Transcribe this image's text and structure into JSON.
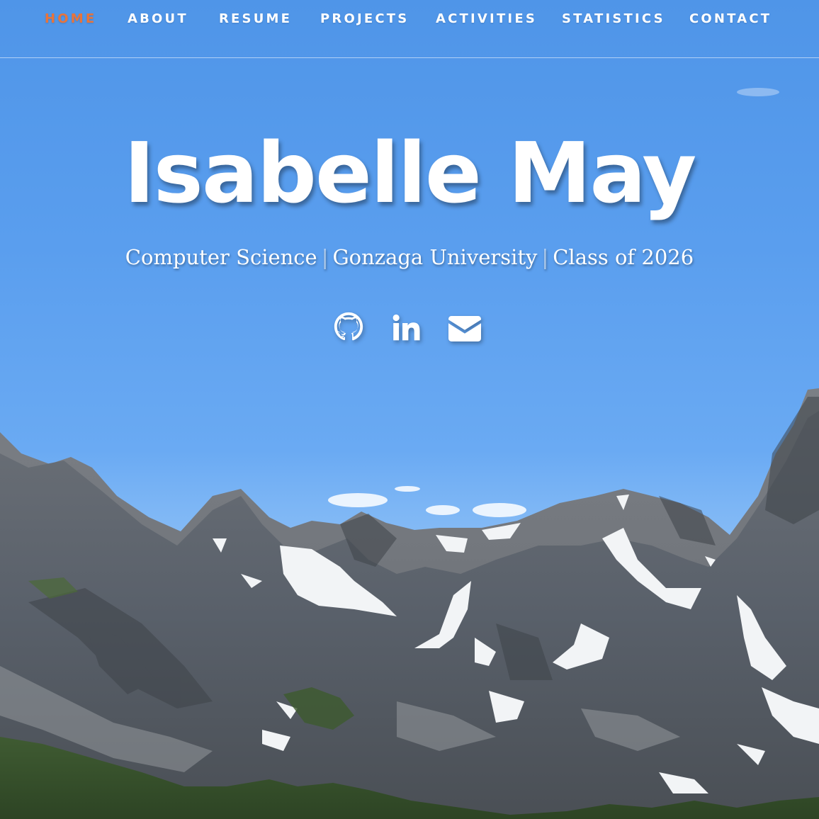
{
  "nav": {
    "items": [
      {
        "label": "HOME",
        "active": true
      },
      {
        "label": "ABOUT",
        "active": false
      },
      {
        "label": "RESUME",
        "active": false
      },
      {
        "label": "PROJECTS",
        "active": false
      },
      {
        "label": "ACTIVITIES",
        "active": false
      },
      {
        "label": "STATISTICS",
        "active": false
      },
      {
        "label": "CONTACT",
        "active": false
      }
    ],
    "active_color": "#e8743b",
    "text_color": "#ffffff"
  },
  "hero": {
    "name": "Isabelle May",
    "subtitle": {
      "major": "Computer Science",
      "school": "Gonzaga University",
      "class": "Class of 2026",
      "separator": "|"
    },
    "social": [
      {
        "icon": "github-icon"
      },
      {
        "icon": "linkedin-icon"
      },
      {
        "icon": "envelope-icon"
      }
    ],
    "background": "mountain-landscape-photo"
  }
}
